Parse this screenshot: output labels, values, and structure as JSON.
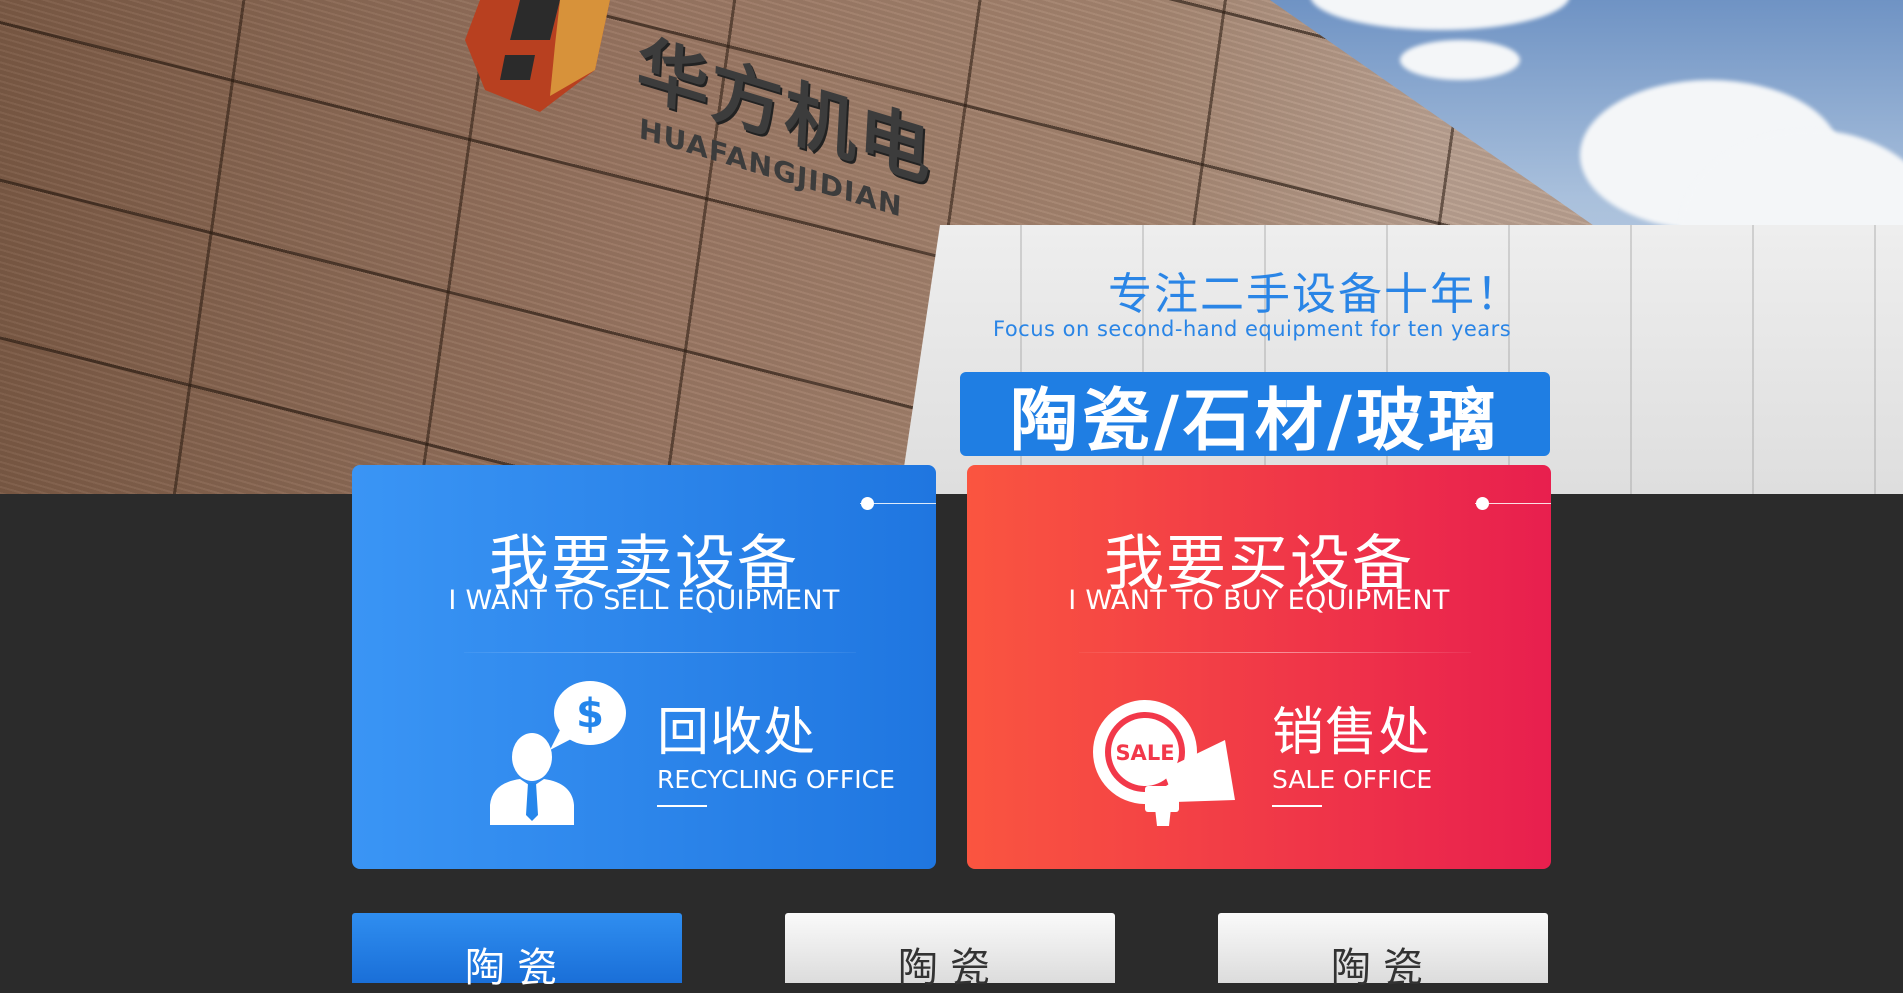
{
  "hero": {
    "brand_cn": "华方机电",
    "brand_en": "HUAFANGJIDIAN",
    "slogan_cn": "专注二手设备十年！",
    "slogan_en": "Focus on second-hand equipment for ten years",
    "category": "陶瓷/石材/玻璃"
  },
  "cards": {
    "sell": {
      "title_cn": "我要卖设备",
      "title_en": "I WANT TO SELL EQUIPMENT",
      "office_cn": "回收处",
      "office_en": "RECYCLING OFFICE",
      "icon": "recycling-person-icon",
      "color": "#2586eb"
    },
    "buy": {
      "title_cn": "我要买设备",
      "title_en": "I WANT TO BUY EQUIPMENT",
      "office_cn": "销售处",
      "office_en": "SALE OFFICE",
      "icon_text": "SALE",
      "icon": "sale-megaphone-icon",
      "color": "#f2384a"
    }
  },
  "tabs": [
    {
      "label": "陶瓷",
      "active": true
    },
    {
      "label": "陶瓷",
      "active": false
    },
    {
      "label": "陶瓷",
      "active": false
    }
  ],
  "colors": {
    "accent_blue": "#1f7ee3",
    "accent_red": "#e81f4e",
    "background_dark": "#2b2b2b"
  }
}
